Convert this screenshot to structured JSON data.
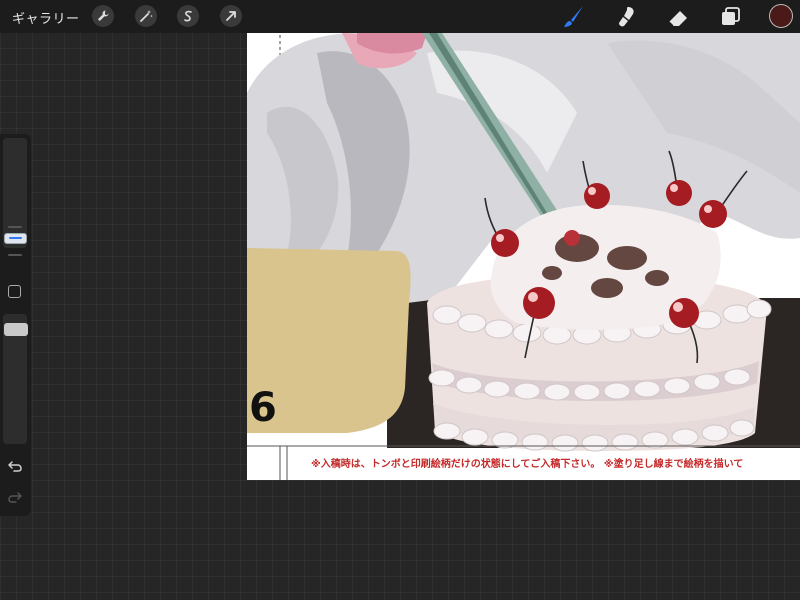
{
  "topbar": {
    "gallery_label": "ギャラリー",
    "left_tools": [
      "wrench-icon",
      "magic-wand-icon",
      "selection-icon",
      "transform-arrow-icon"
    ],
    "right_tools": [
      "brush-icon",
      "smudge-icon",
      "eraser-icon",
      "layers-icon"
    ],
    "active_tool": "brush-icon",
    "accent_color": "#2f7bf5",
    "current_color": "#4a1a18"
  },
  "sidebar": {
    "brush_size": "slider",
    "opacity": "slider",
    "modify_button": "square-icon",
    "undo": "undo-icon",
    "redo": "redo-icon"
  },
  "canvas": {
    "page_number": "6",
    "notice_text": "※入稿時は、トンボと印刷絵柄だけの状態にしてご入稿下さい。 ※塗り足し線まで絵柄を描いて",
    "notice_color": "#c42a2a",
    "background_color": "#ffffff",
    "table_color": "#2b2523",
    "panel_color": "#d9c48e"
  }
}
